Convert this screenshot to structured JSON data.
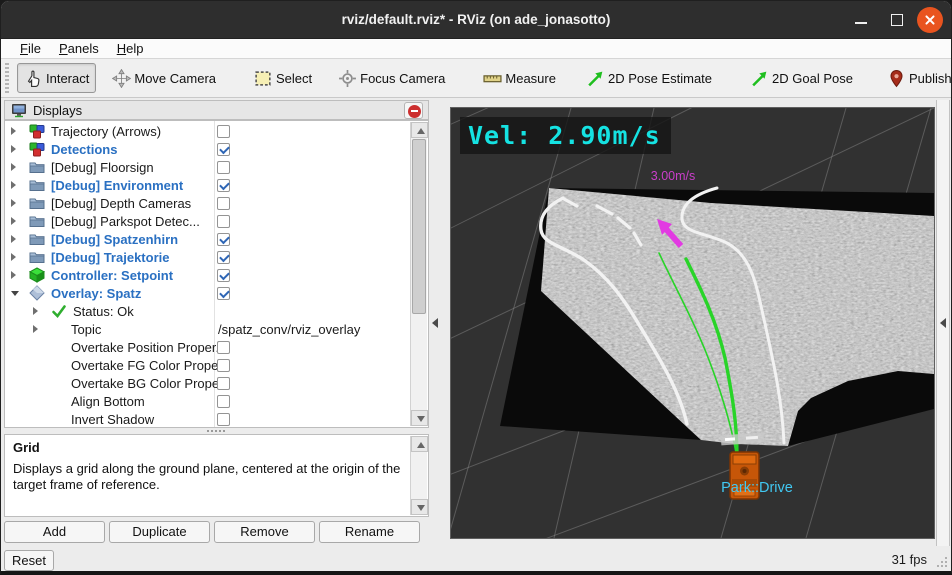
{
  "window": {
    "title": "rviz/default.rviz* - RViz (on ade_jonasotto)"
  },
  "menu": {
    "items": [
      {
        "label": "File"
      },
      {
        "label": "Panels"
      },
      {
        "label": "Help"
      }
    ]
  },
  "toolbar": {
    "buttons": [
      {
        "label": "Interact",
        "icon": "interact-hand-icon",
        "active": true
      },
      {
        "label": "Move Camera",
        "icon": "move-camera-icon",
        "active": false
      },
      {
        "label": "Select",
        "icon": "select-icon",
        "active": false
      },
      {
        "label": "Focus Camera",
        "icon": "focus-camera-icon",
        "active": false
      },
      {
        "label": "Measure",
        "icon": "measure-icon",
        "active": false
      },
      {
        "label": "2D Pose Estimate",
        "icon": "pose-estimate-icon",
        "active": false
      },
      {
        "label": "2D Goal Pose",
        "icon": "goal-pose-icon",
        "active": false
      },
      {
        "label": "Publish Point",
        "icon": "publish-point-icon",
        "active": false
      },
      {
        "label": "",
        "icon": "add-tool-icon",
        "active": false
      }
    ],
    "overflow": "»"
  },
  "displays": {
    "title": "Displays",
    "tree": [
      {
        "label": "Trajectory (Arrows)",
        "icon": "cubes-icon",
        "arrow": "right",
        "indent": 0,
        "checkbox": true,
        "checked": false,
        "bold": false
      },
      {
        "label": "Detections",
        "icon": "cubes-icon",
        "arrow": "right",
        "indent": 0,
        "checkbox": true,
        "checked": true,
        "bold": true
      },
      {
        "label": "[Debug] Floorsign",
        "icon": "folder-icon",
        "arrow": "right",
        "indent": 0,
        "checkbox": true,
        "checked": false,
        "bold": false
      },
      {
        "label": "[Debug] Environment",
        "icon": "folder-icon",
        "arrow": "right",
        "indent": 0,
        "checkbox": true,
        "checked": true,
        "bold": true
      },
      {
        "label": "[Debug] Depth Cameras",
        "icon": "folder-icon",
        "arrow": "right",
        "indent": 0,
        "checkbox": true,
        "checked": false,
        "bold": false
      },
      {
        "label": "[Debug] Parkspot Detec...",
        "icon": "folder-icon",
        "arrow": "right",
        "indent": 0,
        "checkbox": true,
        "checked": false,
        "bold": false
      },
      {
        "label": "[Debug] Spatzenhirn",
        "icon": "folder-icon",
        "arrow": "right",
        "indent": 0,
        "checkbox": true,
        "checked": true,
        "bold": true
      },
      {
        "label": "[Debug] Trajektorie",
        "icon": "folder-icon",
        "arrow": "right",
        "indent": 0,
        "checkbox": true,
        "checked": true,
        "bold": true
      },
      {
        "label": "Controller: Setpoint",
        "icon": "green-cube-icon",
        "arrow": "right",
        "indent": 0,
        "checkbox": true,
        "checked": true,
        "bold": true
      },
      {
        "label": "Overlay: Spatz",
        "icon": "diamond-icon",
        "arrow": "down",
        "indent": 0,
        "checkbox": true,
        "checked": true,
        "bold": true
      },
      {
        "label": "Status: Ok",
        "icon": "status-ok-icon",
        "arrow": "right",
        "indent": 1,
        "checkbox": false,
        "checked": false,
        "bold": false
      },
      {
        "label": "Topic",
        "icon": "",
        "arrow": "right",
        "indent": 1,
        "checkbox": false,
        "checked": false,
        "bold": false,
        "value": "/spatz_conv/rviz_overlay"
      },
      {
        "label": "Overtake Position Proper...",
        "icon": "",
        "arrow": "none",
        "indent": 1,
        "checkbox": true,
        "checked": false,
        "bold": false
      },
      {
        "label": "Overtake FG Color Prope...",
        "icon": "",
        "arrow": "none",
        "indent": 1,
        "checkbox": true,
        "checked": false,
        "bold": false
      },
      {
        "label": "Overtake BG Color Prope...",
        "icon": "",
        "arrow": "none",
        "indent": 1,
        "checkbox": true,
        "checked": false,
        "bold": false
      },
      {
        "label": "Align Bottom",
        "icon": "",
        "arrow": "none",
        "indent": 1,
        "checkbox": true,
        "checked": false,
        "bold": false
      },
      {
        "label": "Invert Shadow",
        "icon": "",
        "arrow": "none",
        "indent": 1,
        "checkbox": true,
        "checked": false,
        "bold": false
      }
    ],
    "help_title": "Grid",
    "help_text": "Displays a grid along the ground plane, centered at the origin of the target frame of reference.",
    "buttons": [
      "Add",
      "Duplicate",
      "Remove",
      "Rename"
    ]
  },
  "statusbar": {
    "reset": "Reset",
    "fps": "31 fps"
  },
  "viewport": {
    "velocity_overlay": "Vel: 2.90m/s",
    "speed_annotation": "3.00m/s",
    "state_label": "Park::Drive",
    "colors": {
      "background": "#313131",
      "grid": "#909090",
      "velocity_text": "#15e2e2",
      "speed_annotation": "#cb3ecb",
      "state_label": "#41c8f2",
      "trajectory": "#28d428",
      "vehicle": "#c65608",
      "pose_arrow": "#e23ae2",
      "road_line": "#f2f2f2",
      "enabled_row": "#2a70c2"
    }
  }
}
